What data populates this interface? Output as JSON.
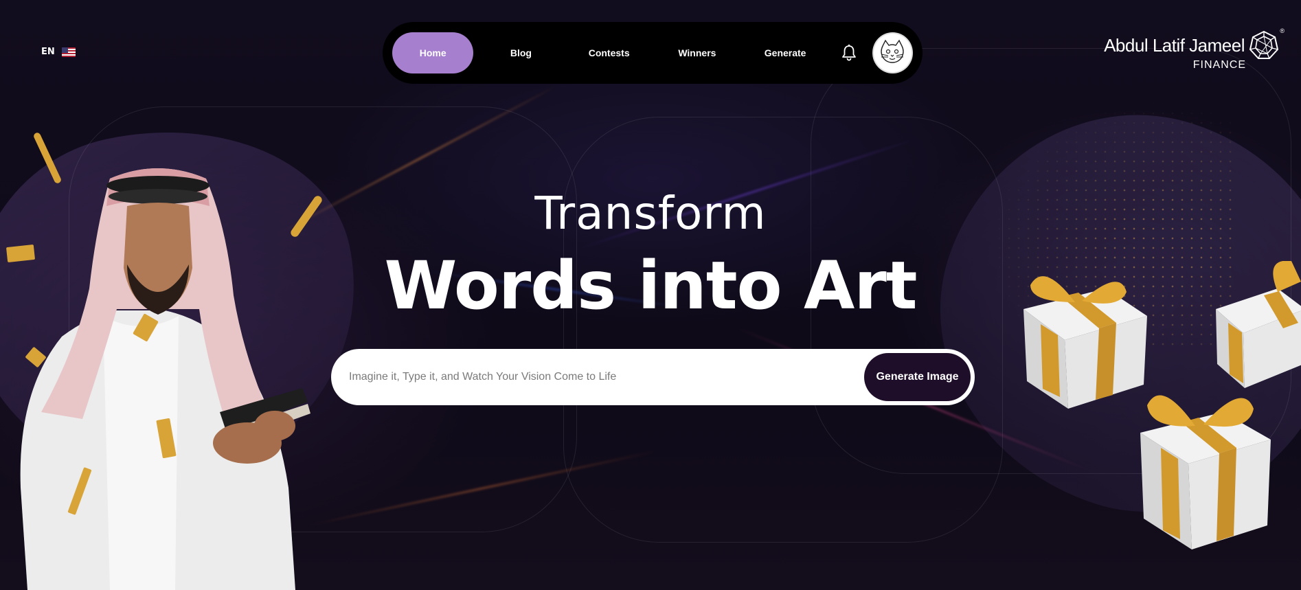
{
  "language": {
    "code": "EN",
    "flag": "us-flag-icon"
  },
  "nav": {
    "items": [
      {
        "label": "Home",
        "active": true
      },
      {
        "label": "Blog",
        "active": false
      },
      {
        "label": "Contests",
        "active": false
      },
      {
        "label": "Winners",
        "active": false
      },
      {
        "label": "Generate",
        "active": false
      }
    ],
    "active_color": "#a77fcf",
    "notification_icon": "bell-icon",
    "avatar_icon": "cat-avatar-icon"
  },
  "brand": {
    "name": "Abdul Latif Jameel",
    "sub": "FINANCE",
    "registered": "®"
  },
  "hero": {
    "line1": "Transform",
    "line2": "Words into Art",
    "search_placeholder": "Imagine it, Type it, and Watch Your Vision Come to Life",
    "search_value": "",
    "button_label": "Generate Image"
  },
  "colors": {
    "background": "#0f0b1a",
    "button_dark": "#1f0e29",
    "gold": "#d8a437"
  }
}
